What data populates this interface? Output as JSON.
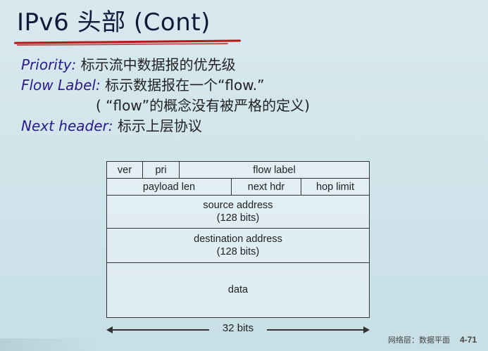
{
  "slide": {
    "title": "IPv6 头部 (Cont)",
    "bullets": [
      {
        "term": "Priority:",
        "desc": " 标示流中数据报的优先级"
      },
      {
        "term": "Flow Label:",
        "desc": " 标示数据报在一个“flow.”"
      },
      {
        "term": "",
        "desc": "( “flow”的概念没有被严格的定义)"
      },
      {
        "term": "Next header:",
        "desc": " 标示上层协议"
      }
    ],
    "header_diagram": {
      "row1": {
        "ver": "ver",
        "pri": "pri",
        "flow_label": "flow label"
      },
      "row2": {
        "payload_len": "payload len",
        "next_hdr": "next hdr",
        "hop_limit": "hop limit"
      },
      "row3": {
        "line1": "source address",
        "line2": "(128 bits)"
      },
      "row4": {
        "line1": "destination address",
        "line2": "(128 bits)"
      },
      "row5": {
        "data": "data"
      }
    },
    "ruler_label": "32 bits",
    "footer": {
      "section": "网络层：数据平面",
      "page": "4-71"
    }
  }
}
